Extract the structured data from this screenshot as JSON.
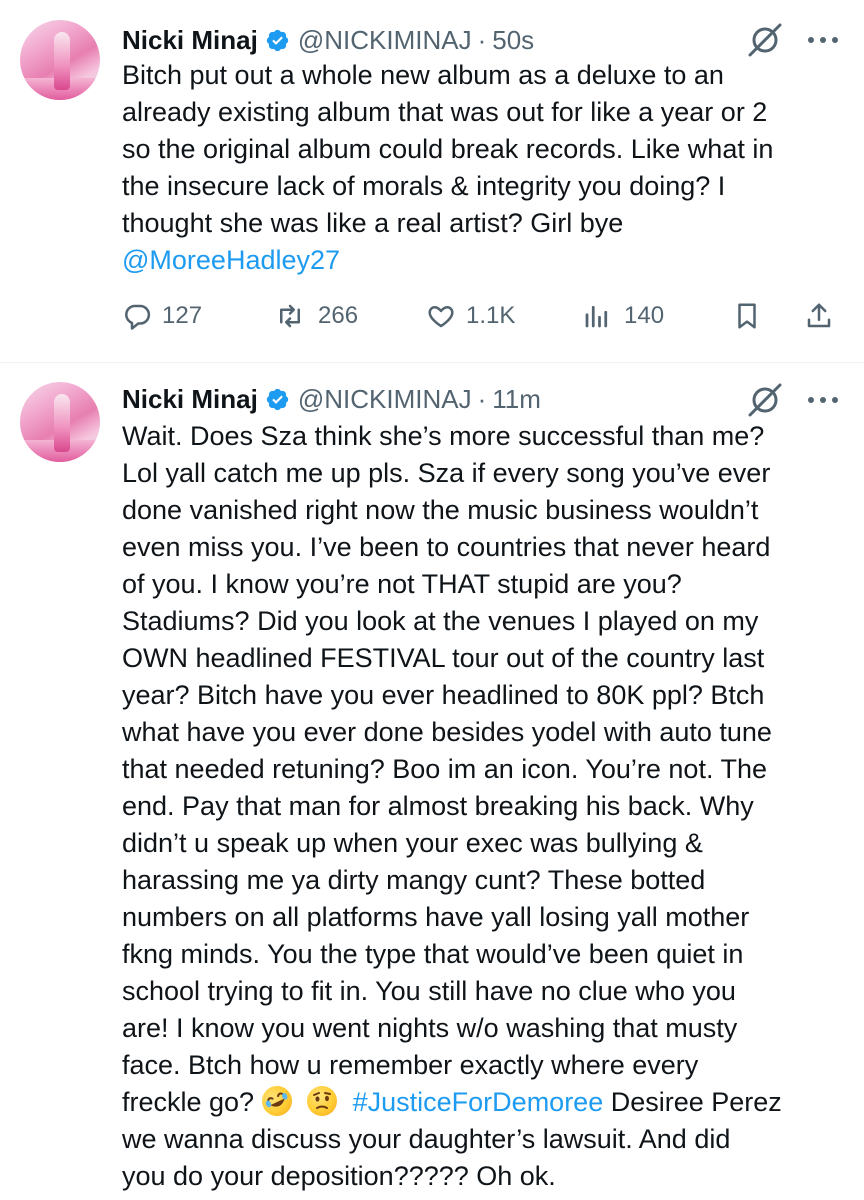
{
  "tweets": [
    {
      "author": {
        "name": "Nicki Minaj",
        "handle": "@NICKIMINAJ",
        "time": "50s",
        "separator": "·"
      },
      "text_lines": [
        "Bitch put out a whole new album as a deluxe to an",
        "already existing album that was out for like a year or 2",
        "so the original album could break records. Like what in",
        "the insecure lack of morals & integrity you doing? I",
        "thought she was like a real artist? Girl bye"
      ],
      "mention": "@MoreeHadley27",
      "stats": {
        "replies": "127",
        "reposts": "266",
        "likes": "1.1K",
        "views": "140"
      },
      "icons": [
        "reply-icon",
        "repost-icon",
        "like-icon",
        "views-icon",
        "bookmark-icon",
        "share-icon",
        "grok-icon",
        "more-icon",
        "verified-badge-icon"
      ]
    },
    {
      "author": {
        "name": "Nicki Minaj",
        "handle": "@NICKIMINAJ",
        "time": "11m",
        "separator": "·"
      },
      "text_lines": [
        "Wait. Does Sza think she’s more successful than me?",
        "Lol yall catch me up pls. Sza if every song you’ve ever",
        "done vanished right now the music business wouldn’t",
        "even miss you. I’ve been to countries that never heard",
        "of you. I know you’re not THAT stupid are you?",
        "Stadiums? Did you look at the venues I played on my",
        "OWN headlined FESTIVAL tour out of the country last",
        "year? Bitch have you ever headlined to 80K ppl? Btch",
        "what have you ever done besides yodel with auto tune",
        "that needed retuning? Boo im an icon. You’re not. The",
        "end. Pay that man for almost breaking his back. Why",
        "didn’t u speak up when your exec was bullying &",
        "harassing me ya dirty mangy cunt? These botted",
        "numbers on all platforms have yall losing yall mother",
        "fkng minds. You the type that would’ve been quiet in",
        "school trying to fit in. You still have no clue who you",
        "are! I know you went nights w/o washing that musty",
        "face. Btch how u remember exactly where every"
      ],
      "emoji_line": {
        "prefix": "freckle go?",
        "emojis": [
          "rolling-on-floor-laughing-emoji",
          "face-with-raised-eyebrow-emoji"
        ],
        "hashtag": "#JusticeForDemoree",
        "suffix": "Desiree Perez"
      },
      "tail_lines": [
        "we wanna discuss your daughter’s lawsuit. And did",
        "you do your deposition????? Oh ok."
      ]
    }
  ],
  "colors": {
    "link": "#1d9bf0",
    "secondary_text": "#536471",
    "verified": "#1d9bf0",
    "divider": "#eff3f4"
  }
}
